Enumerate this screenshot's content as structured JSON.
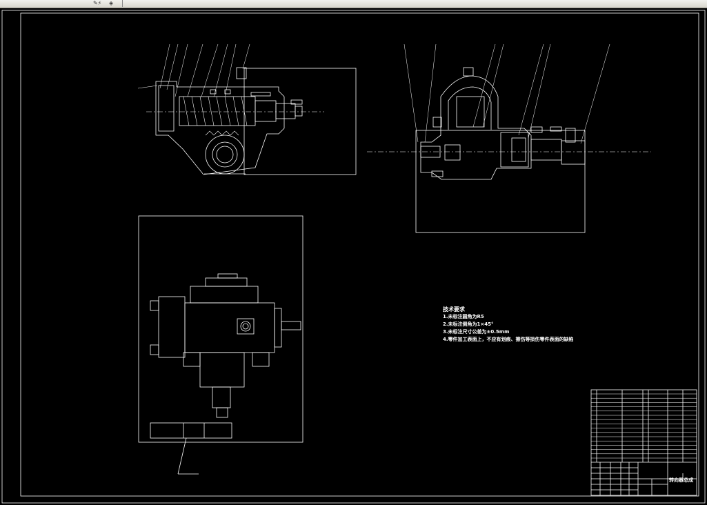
{
  "window": {
    "background": "#000000",
    "line_color": "#ffffff",
    "border_color": "#ffffff"
  },
  "toolbar": {
    "icons": [
      "snap-icon",
      "settings-icon"
    ]
  },
  "tech_notes": {
    "title": "技术要求",
    "lines": [
      "1.未标注圆角为R5",
      "2.未标注倒角为1×45°",
      "3.未标注尺寸公差为±0.5mm",
      "4.零件加工表面上，不应有划痕、擦伤等损伤零件表面的缺陷"
    ]
  },
  "title_block": {
    "drawing_name": "转向器总成"
  }
}
